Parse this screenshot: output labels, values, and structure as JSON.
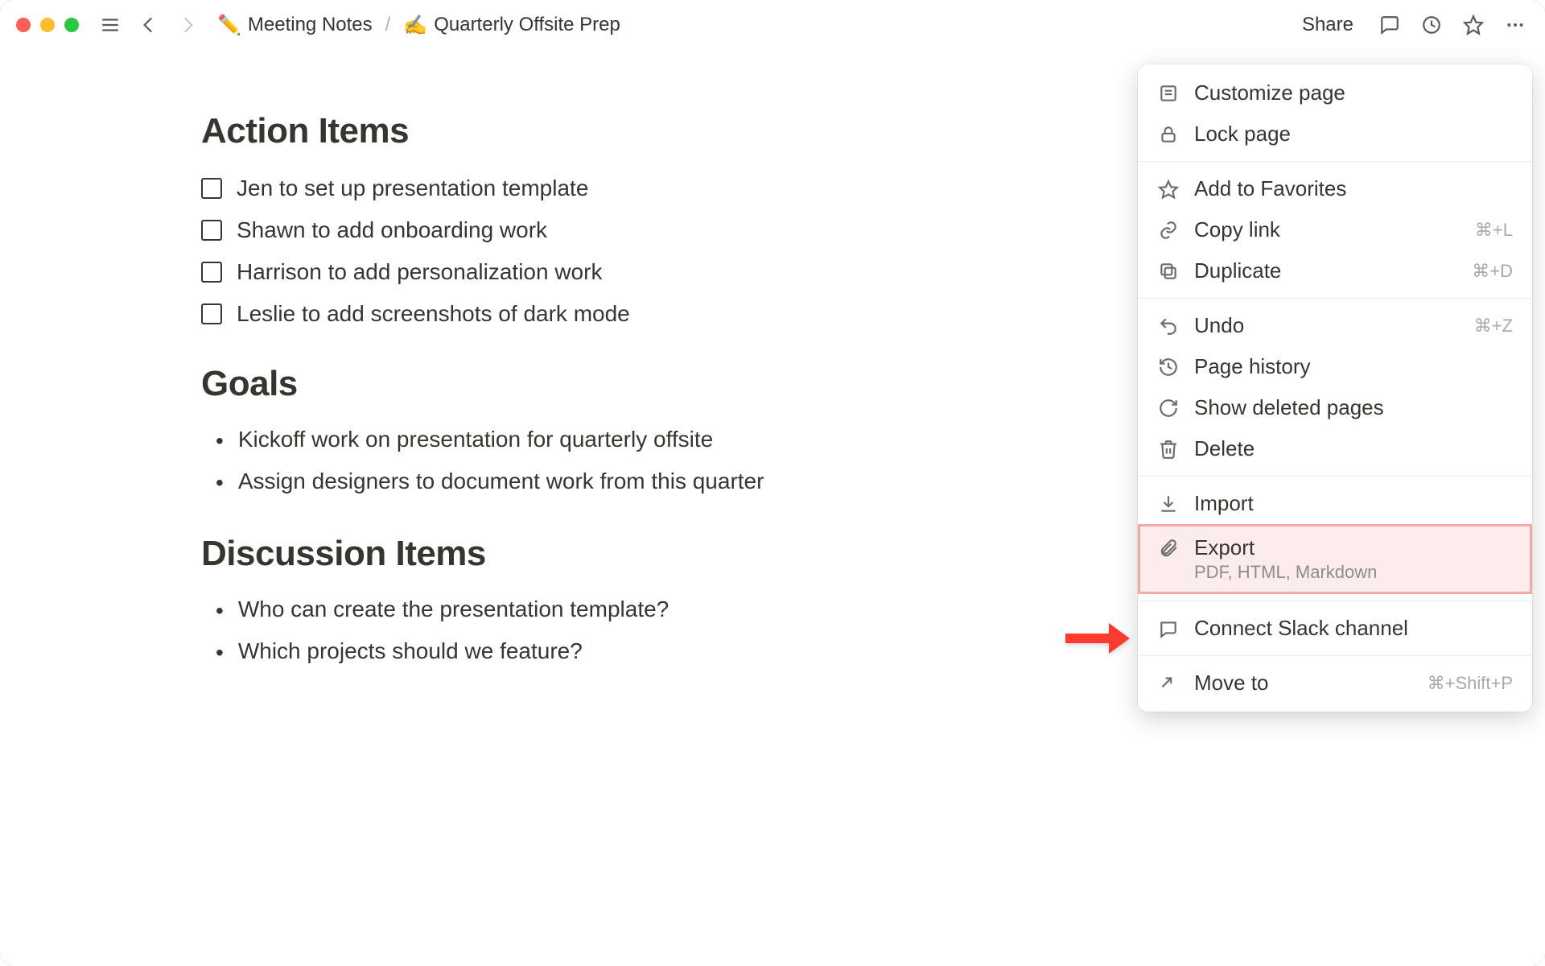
{
  "breadcrumbs": {
    "parent_emoji": "✏️",
    "parent_label": "Meeting Notes",
    "separator": "/",
    "current_emoji": "✍️",
    "current_label": "Quarterly Offsite Prep"
  },
  "topbar": {
    "share_label": "Share"
  },
  "sections": {
    "action_items_title": "Action Items",
    "goals_title": "Goals",
    "discussion_title": "Discussion Items"
  },
  "action_items": [
    "Jen to set up presentation template",
    "Shawn to add onboarding work",
    "Harrison to add personalization work",
    "Leslie to add screenshots of dark mode"
  ],
  "goals": [
    "Kickoff work on presentation for quarterly offsite",
    "Assign designers to document work from this quarter"
  ],
  "discussion": [
    "Who can create the presentation template?",
    "Which projects should we feature?"
  ],
  "menu": {
    "customize": "Customize page",
    "lock": "Lock page",
    "favorites": "Add to Favorites",
    "copy_link": "Copy link",
    "copy_link_shortcut": "⌘+L",
    "duplicate": "Duplicate",
    "duplicate_shortcut": "⌘+D",
    "undo": "Undo",
    "undo_shortcut": "⌘+Z",
    "history": "Page history",
    "deleted": "Show deleted pages",
    "delete": "Delete",
    "import": "Import",
    "export": "Export",
    "export_sub": "PDF, HTML, Markdown",
    "slack": "Connect Slack channel",
    "move": "Move to",
    "move_shortcut": "⌘+Shift+P"
  }
}
